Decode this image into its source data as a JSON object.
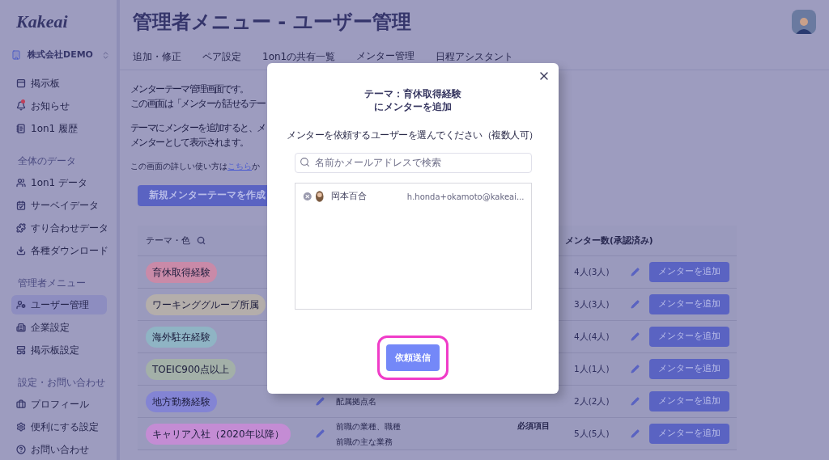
{
  "sidebar": {
    "logo": "Kakeai",
    "company": "株式会社DEMO",
    "groups": [
      {
        "items": [
          {
            "label": "掲示板",
            "selected": false,
            "unread": false
          },
          {
            "label": "お知らせ",
            "selected": false,
            "unread": true
          },
          {
            "label": "1on1 履歴",
            "selected": false,
            "unread": false
          }
        ]
      },
      {
        "heading": "全体のデータ",
        "items": [
          {
            "label": "1on1 データ",
            "selected": false,
            "unread": false
          },
          {
            "label": "サーベイデータ",
            "selected": false,
            "unread": false
          },
          {
            "label": "すり合わせデータ",
            "selected": false,
            "unread": false
          },
          {
            "label": "各種ダウンロード",
            "selected": false,
            "unread": false
          }
        ]
      },
      {
        "heading": "管理者メニュー",
        "items": [
          {
            "label": "ユーザー管理",
            "selected": true,
            "unread": false
          },
          {
            "label": "企業設定",
            "selected": false,
            "unread": false
          },
          {
            "label": "掲示板設定",
            "selected": false,
            "unread": false
          }
        ]
      },
      {
        "heading": "設定・お問い合わせ",
        "items": [
          {
            "label": "プロフィール",
            "selected": false,
            "unread": false
          },
          {
            "label": "便利にする設定",
            "selected": false,
            "unread": false
          },
          {
            "label": "お問い合わせ",
            "selected": false,
            "unread": false
          }
        ]
      }
    ]
  },
  "page": {
    "title": "管理者メニュー - ユーザー管理",
    "tabs": [
      {
        "label": "追加・修正",
        "selected": false
      },
      {
        "label": "ペア設定",
        "selected": false
      },
      {
        "label": "1on1の共有一覧",
        "selected": false
      },
      {
        "label": "メンター管理",
        "selected": true
      },
      {
        "label": "日程アシスタント",
        "selected": false
      }
    ],
    "paragraphs": [
      [
        "メンターテーマ管理画面です。",
        "この画面は「メンターが話せるテー"
      ],
      [
        "テーマにメンターを追加すると、メ",
        "メンターとして表示されます。"
      ]
    ],
    "help_text": "この画面の詳しい使い方は",
    "help_link": "こちら",
    "help_after": "か",
    "create_button": "新規メンターテーマを作成",
    "table": {
      "columns": [
        "テーマ・色",
        "メンター数(承認済み)"
      ],
      "rows": [
        {
          "theme": "育休取得経験",
          "color": "#c98aa8",
          "count": "4人(3人)",
          "action": "メンターを追加"
        },
        {
          "theme": "ワーキンググループ所属",
          "color": "#b4aeab",
          "count": "3人(3人)",
          "action": "メンターを追加"
        },
        {
          "theme": "海外駐在経験",
          "color": "#8fb4c4",
          "count": "4人(4人)",
          "action": "メンターを追加"
        },
        {
          "theme": "TOEIC900点以上",
          "color": "#a3b0a8",
          "count": "1人(1人)",
          "action": "メンターを追加"
        },
        {
          "theme": "地方勤務経験",
          "color": "#8384d4",
          "count": "2人(2人)",
          "action": "メンターを追加",
          "details": [
            "配属拠点名"
          ]
        },
        {
          "theme": "キャリア入社（2020年以降）",
          "color": "#c48cd4",
          "count": "5人(5人)",
          "action": "メンターを追加",
          "details": [
            "前職の業種、職種",
            "前職の主な業務"
          ],
          "tag": "必須項目"
        }
      ]
    }
  },
  "modal": {
    "title": [
      "テーマ：育休取得経験",
      "にメンターを追加"
    ],
    "instruction": "メンターを依頼するユーザーを選んでください（複数人可）",
    "search": {
      "placeholder": "名前かメールアドレスで検索"
    },
    "selected_users": [
      {
        "name": "岡本百合",
        "email": "h.honda+okamoto@kakeai..."
      }
    ],
    "submit": {
      "label": "依頼送信",
      "highlighted": true
    }
  }
}
